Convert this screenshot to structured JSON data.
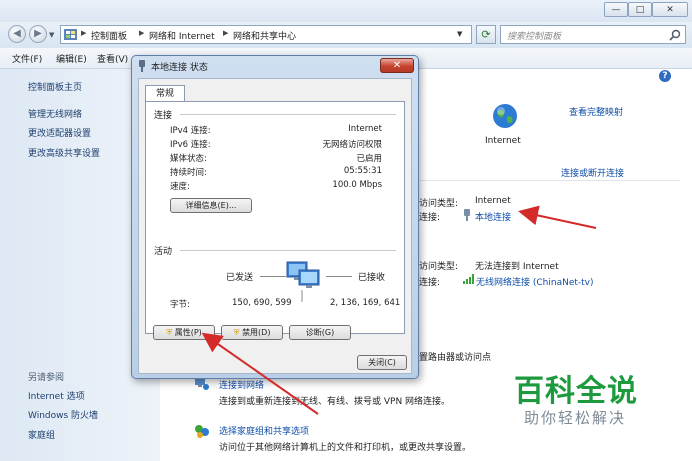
{
  "window": {
    "caption_buttons": [
      "—",
      "□",
      "✕"
    ]
  },
  "address_bar": {
    "breadcrumb": [
      "控制面板",
      "网络和 Internet",
      "网络和共享中心"
    ],
    "search_placeholder": "搜索控制面板"
  },
  "menu": [
    "文件(F)",
    "编辑(E)",
    "查看(V)"
  ],
  "sidebar": {
    "items": [
      "控制面板主页",
      "管理无线网络",
      "更改适配器设置",
      "更改高级共享设置"
    ],
    "see_also_title": "另请参阅",
    "see_also": [
      "Internet 选项",
      "Windows 防火墙",
      "家庭组"
    ]
  },
  "main": {
    "view_full_map": "查看完整映射",
    "internet_label": "Internet",
    "connect_disconnect": "连接或断开连接",
    "net1": {
      "access_type_label": "访问类型:",
      "access_type_value": "Internet",
      "connections_label": "连接:",
      "connection_link": "本地连接"
    },
    "net2": {
      "access_type_label": "访问类型:",
      "access_type_value": "无法连接到 Internet",
      "connections_label": "连接:",
      "connection_link": "无线网络连接 (ChinaNet-tv)"
    },
    "router_text": "置路由器或访问点",
    "connect_network_link": "连接到网络",
    "connect_network_desc": "连接到或重新连接到无线、有线、拨号或 VPN 网络连接。",
    "homegroup_link": "选择家庭组和共享选项",
    "homegroup_desc": "访问位于其他网络计算机上的文件和打印机，或更改共享设置。"
  },
  "dialog": {
    "title": "本地连接 状态",
    "close_glyph": "✕",
    "tab": "常规",
    "connection_group": "连接",
    "rows": [
      {
        "label": "IPv4 连接:",
        "value": "Internet"
      },
      {
        "label": "IPv6 连接:",
        "value": "无网络访问权限"
      },
      {
        "label": "媒体状态:",
        "value": "已启用"
      },
      {
        "label": "持续时间:",
        "value": "05:55:31"
      },
      {
        "label": "速度:",
        "value": "100.0 Mbps"
      }
    ],
    "details_button": "详细信息(E)...",
    "activity_group": "活动",
    "sent_label": "已发送",
    "received_label": "已接收",
    "bytes_label": "字节:",
    "bytes_sent": "150, 690, 599",
    "bytes_received": "2, 136, 169, 641",
    "properties_button": "属性(P)",
    "disable_button": "禁用(D)",
    "diagnose_button": "诊断(G)",
    "close_button": "关闭(C)"
  },
  "watermark": {
    "title": "百科全说",
    "subtitle": "助你轻松解决"
  },
  "colors": {
    "link": "#0f4fa8",
    "arrow": "#d42a2a",
    "watermark_green": "#1e9a3e"
  }
}
